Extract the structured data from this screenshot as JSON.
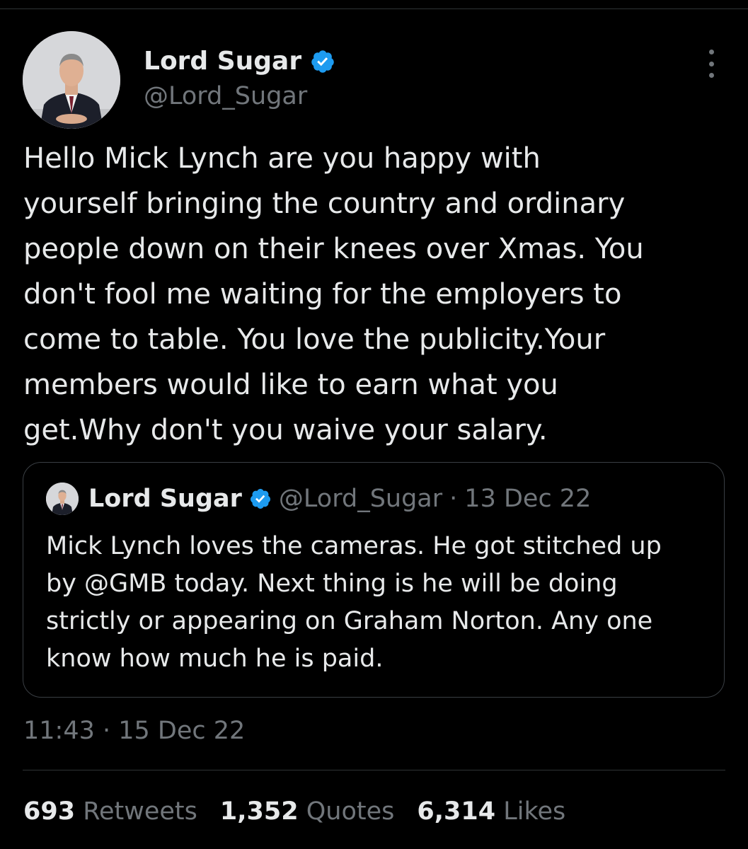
{
  "tweet": {
    "author_name": "Lord Sugar",
    "author_handle": "@Lord_Sugar",
    "verified": true,
    "text": "Hello Mick Lynch are you happy with\nyourself bringing the country and ordinary\npeople down on their knees over Xmas. You\ndon't fool me waiting for the employers to\ncome to table. You love the publicity.Your\nmembers would like to earn what you\nget.Why don't you waive your salary.",
    "timestamp": "11:43 · 15 Dec 22"
  },
  "quoted_tweet": {
    "author_name": "Lord Sugar",
    "author_handle": "@Lord_Sugar",
    "separator": "·",
    "date": "13 Dec 22",
    "text": "Mick Lynch loves the cameras. He got stitched up\nby @GMB today. Next thing is he will be doing\nstrictly or appearing on Graham Norton. Any one\nknow how much he is paid."
  },
  "stats": [
    {
      "count": "693",
      "label": "Retweets"
    },
    {
      "count": "1,352",
      "label": "Quotes"
    },
    {
      "count": "6,314",
      "label": "Likes"
    }
  ],
  "colors": {
    "background": "#000000",
    "text": "#e7e9ea",
    "secondary": "#71767b",
    "verified": "#1d9bf0",
    "border": "#2f3336"
  },
  "icons": {
    "verified": "verified-badge-icon",
    "more": "more-options-icon"
  }
}
